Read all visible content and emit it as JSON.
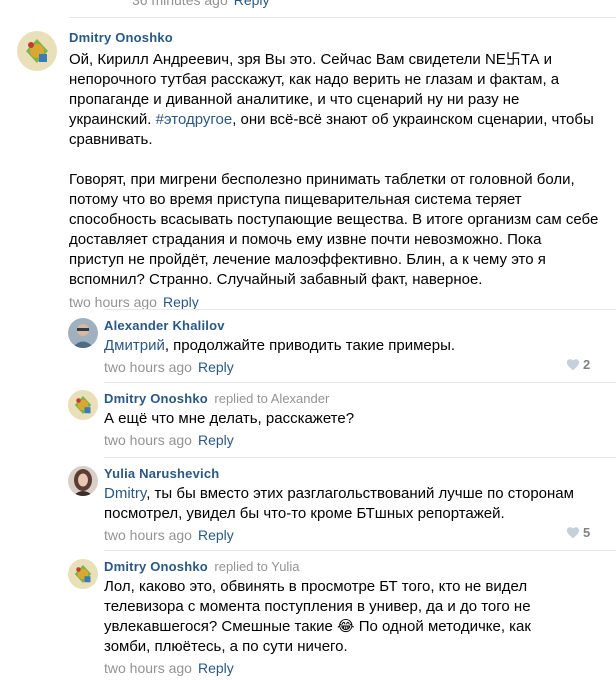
{
  "top_meta": {
    "time": "36 minutes ago",
    "reply": "Reply"
  },
  "comments": [
    {
      "author": "Dmitry Onoshko",
      "replied_to": "",
      "p1_a": "Ой, Кирилл Андреевич, зря Вы это. Сейчас Вам свидетели NE",
      "p1_glyph": "卐",
      "p1_b": "ТА и непорочного тутбая расскажут, как надо верить не глазам и фактам, а пропаганде и диванной аналитике, и что сценарий ну ни разу не украинский.",
      "hashtag": "#этодругое",
      "p1_c": ", они всё-всё знают об украинском сценарии, чтобы сравнивать.",
      "p2": "Говорят, при мигрени бесполезно принимать таблетки от головной боли, потому что во время приступа пищеварительная система теряет способность всасывать поступающие вещества. В итоге организм сам себе доставляет страдания и помочь ему извне почти невозможно. Пока приступ не пройдёт, лечение малоэффективно. Блин, а к чему это я вспомнил? Странно. Случайный забавный факт, наверное.",
      "time": "two hours ago",
      "reply": "Reply"
    },
    {
      "author": "Alexander Khalilov",
      "mention": "Дмитрий",
      "text": ", продолжайте приводить такие примеры.",
      "time": "two hours ago",
      "reply": "Reply",
      "likes": "2"
    },
    {
      "author": "Dmitry Onoshko",
      "replied_to": "replied to Alexander",
      "text": "А ещё что мне делать, расскажете?",
      "time": "two hours ago",
      "reply": "Reply"
    },
    {
      "author": "Yulia Narushevich",
      "mention": "Dmitry",
      "text": ", ты бы вместо этих разглагольствований лучше по сторонам посмотрел, увидел бы что-то кроме БТшных репортажей.",
      "time": "two hours ago",
      "reply": "Reply",
      "likes": "5"
    },
    {
      "author": "Dmitry Onoshko",
      "replied_to": "replied to Yulia",
      "text_a": "Лол, каково это, обвинять в просмотре БТ того, кто не видел телевизора с момента поступления в универ, да и до того не увлекавшегося? Смешные такие ",
      "emoji": "😂",
      "text_b": " По одной методичке, как зомби, плюётесь, а по сути ничего.",
      "time": "two hours ago",
      "reply": "Reply"
    }
  ],
  "icons": {
    "like": "heart-icon",
    "avatar_dmitry": "dmitry-avatar",
    "avatar_alexander": "alexander-avatar",
    "avatar_yulia": "yulia-avatar"
  },
  "colors": {
    "link": "#2a5885",
    "meta": "#939393",
    "separator": "#e7e8ec"
  }
}
